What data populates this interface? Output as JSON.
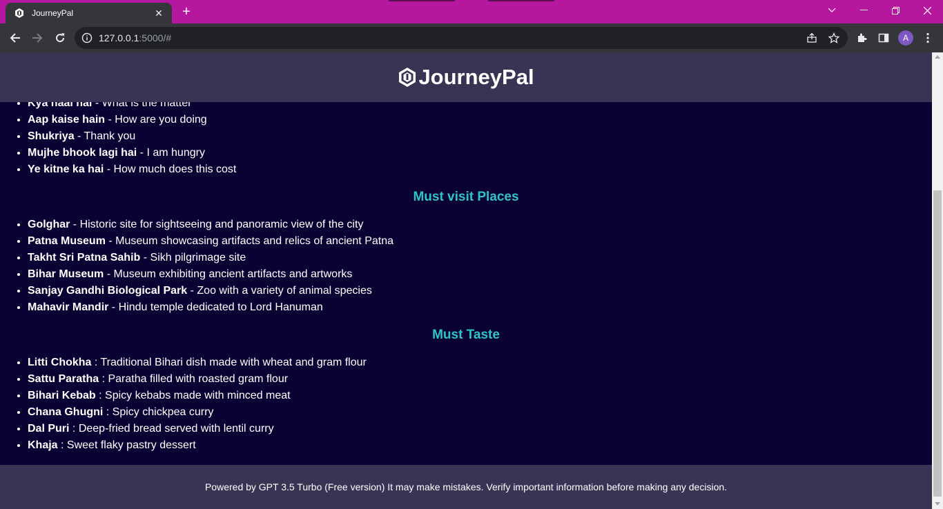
{
  "browser": {
    "tab_title": "JourneyPal",
    "tab_close": "✕",
    "new_tab": "+",
    "url_host": "127.0.0.1",
    "url_rest": ":5000/#",
    "profile_initial": "A",
    "icons": [
      "favicon-icon",
      "back-arrow-icon",
      "forward-arrow-icon",
      "reload-icon",
      "site-info-icon",
      "share-icon",
      "bookmark-star-icon",
      "extensions-icon",
      "side-panel-icon",
      "kebab-menu-icon",
      "minimize-icon",
      "restore-icon",
      "close-icon",
      "tab-search-icon"
    ],
    "accent_color": "#b5179e"
  },
  "site": {
    "brand": "JourneyPal",
    "colors": {
      "background": "#0b0132",
      "header": "#3b3354",
      "heading": "#2ec4c6"
    }
  },
  "phrases": {
    "items": [
      {
        "term": "Kya haal hai",
        "sep": " - ",
        "desc": "What is the matter"
      },
      {
        "term": "Aap kaise hain",
        "sep": " - ",
        "desc": "How are you doing"
      },
      {
        "term": "Shukriya",
        "sep": " - ",
        "desc": "Thank you"
      },
      {
        "term": "Mujhe bhook lagi hai",
        "sep": " - ",
        "desc": "I am hungry"
      },
      {
        "term": "Ye kitne ka hai",
        "sep": " - ",
        "desc": "How much does this cost"
      }
    ]
  },
  "places": {
    "title": "Must visit Places",
    "items": [
      {
        "term": "Golghar",
        "sep": " - ",
        "desc": "Historic site for sightseeing and panoramic view of the city"
      },
      {
        "term": "Patna Museum",
        "sep": " - ",
        "desc": "Museum showcasing artifacts and relics of ancient Patna"
      },
      {
        "term": "Takht Sri Patna Sahib",
        "sep": " - ",
        "desc": "Sikh pilgrimage site"
      },
      {
        "term": "Bihar Museum",
        "sep": " - ",
        "desc": "Museum exhibiting ancient artifacts and artworks"
      },
      {
        "term": "Sanjay Gandhi Biological Park",
        "sep": " - ",
        "desc": "Zoo with a variety of animal species"
      },
      {
        "term": "Mahavir Mandir",
        "sep": " - ",
        "desc": "Hindu temple dedicated to Lord Hanuman"
      }
    ]
  },
  "taste": {
    "title": "Must Taste",
    "items": [
      {
        "term": "Litti Chokha",
        "sep": " : ",
        "desc": "Traditional Bihari dish made with wheat and gram flour"
      },
      {
        "term": "Sattu Paratha",
        "sep": " : ",
        "desc": "Paratha filled with roasted gram flour"
      },
      {
        "term": "Bihari Kebab",
        "sep": " : ",
        "desc": "Spicy kebabs made with minced meat"
      },
      {
        "term": "Chana Ghugni",
        "sep": " : ",
        "desc": "Spicy chickpea curry"
      },
      {
        "term": "Dal Puri",
        "sep": " : ",
        "desc": "Deep-fried bread served with lentil curry"
      },
      {
        "term": "Khaja",
        "sep": " : ",
        "desc": "Sweet flaky pastry dessert"
      }
    ]
  },
  "footer": {
    "text": "Powered by GPT 3.5 Turbo (Free version) It may make mistakes. Verify important information before making any decision."
  }
}
